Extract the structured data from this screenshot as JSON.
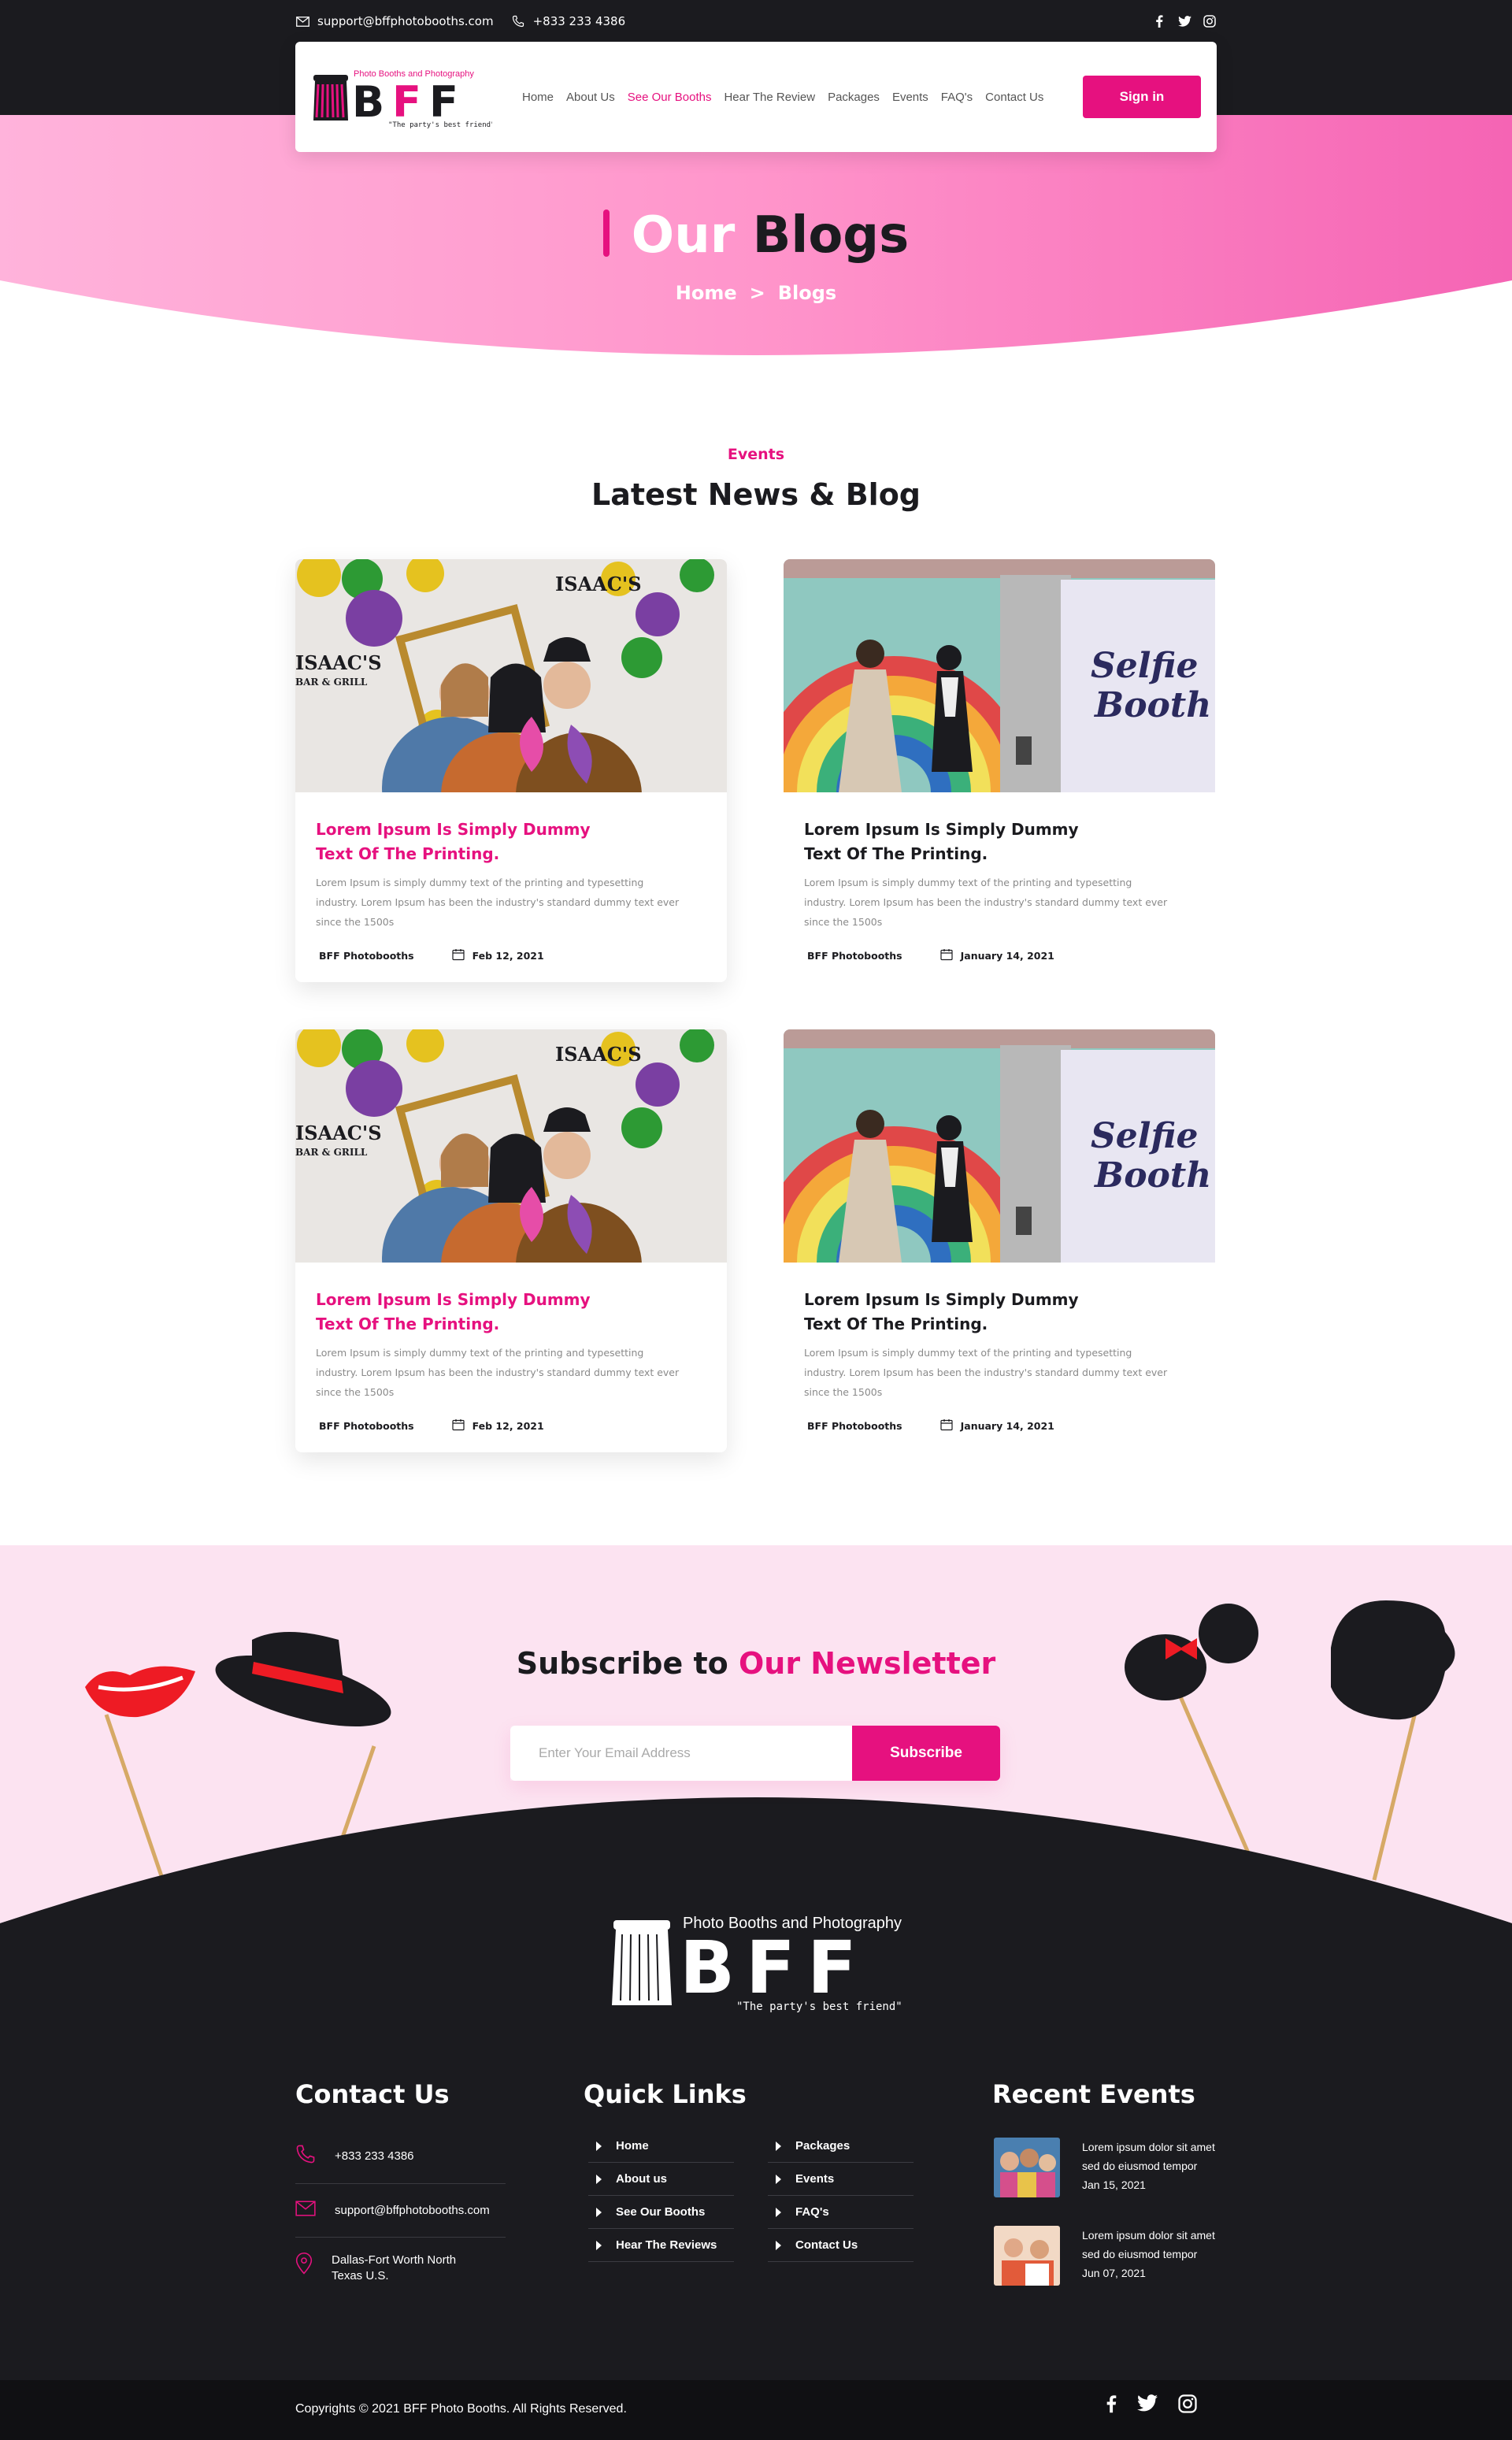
{
  "topbar": {
    "email": "support@bffphotobooths.com",
    "phone": "+833 233 4386"
  },
  "brand": {
    "name": "BFF",
    "tagline_top": "Photo Booths and Photography",
    "tagline_bottom": "\"The party's best friend\""
  },
  "nav": {
    "items": [
      {
        "label": "Home",
        "active": false
      },
      {
        "label": "About Us",
        "active": false
      },
      {
        "label": "See Our Booths",
        "active": true
      },
      {
        "label": "Hear The Review",
        "active": false
      },
      {
        "label": "Packages",
        "active": false
      },
      {
        "label": "Events",
        "active": false
      },
      {
        "label": "FAQ's",
        "active": false
      },
      {
        "label": "Contact Us",
        "active": false
      }
    ],
    "signin_label": "Sign in"
  },
  "hero": {
    "title_word1": "Our",
    "title_word2": "Blogs",
    "breadcrumb_home": "Home",
    "breadcrumb_sep": ">",
    "breadcrumb_current": "Blogs"
  },
  "blog": {
    "tag": "Events",
    "title": "Latest News & Blog",
    "posts": [
      {
        "title": "Lorem Ipsum Is Simply Dummy Text Of The Printing.",
        "desc": "Lorem Ipsum is simply dummy text of the printing and typesetting industry. Lorem Ipsum has been the industry's standard dummy text ever since the 1500s",
        "author": "BFF Photobooths",
        "date": "Feb 12, 2021",
        "image": "party-frame-photo"
      },
      {
        "title": "Lorem Ipsum Is Simply Dummy Text Of The Printing.",
        "desc": "Lorem Ipsum is simply dummy text of the printing and typesetting industry. Lorem Ipsum has been the industry's standard dummy text ever since the 1500s",
        "author": "BFF Photobooths",
        "date": "January 14, 2021",
        "image": "selfie-booth-photo"
      },
      {
        "title": "Lorem Ipsum Is Simply Dummy Text Of The Printing.",
        "desc": "Lorem Ipsum is simply dummy text of the printing and typesetting industry. Lorem Ipsum has been the industry's standard dummy text ever since the 1500s",
        "author": "BFF Photobooths",
        "date": "Feb 12, 2021",
        "image": "party-frame-photo"
      },
      {
        "title": "Lorem Ipsum Is Simply Dummy Text Of The Printing.",
        "desc": "Lorem Ipsum is simply dummy text of the printing and typesetting industry. Lorem Ipsum has been the industry's standard dummy text ever since the 1500s",
        "author": "BFF Photobooths",
        "date": "January 14, 2021",
        "image": "selfie-booth-photo"
      }
    ],
    "image_text": {
      "isaacs": "ISAAC'S",
      "bar_grill": "BAR & GRILL",
      "selfie": "Selfie",
      "booth": "Booth"
    }
  },
  "newsletter": {
    "title_plain": "Subscribe to",
    "title_accent": "Our Newsletter",
    "placeholder": "Enter Your Email Address",
    "button": "Subscribe"
  },
  "footer": {
    "contact_title": "Contact Us",
    "phone": "+833 233 4386",
    "email": "support@bffphotobooths.com",
    "address_line1": "Dallas-Fort Worth North",
    "address_line2": "Texas U.S.",
    "links_title": "Quick Links",
    "links_col1": [
      "Home",
      "About us",
      "See Our Booths",
      "Hear The Reviews"
    ],
    "links_col2": [
      "Packages",
      "Events",
      "FAQ's",
      "Contact Us"
    ],
    "events_title": "Recent Events",
    "events": [
      {
        "line1": "Lorem ipsum dolor sit amet",
        "line2": "sed do eiusmod tempor",
        "date": "Jan 15, 2021"
      },
      {
        "line1": "Lorem ipsum dolor sit amet",
        "line2": "sed do eiusmod tempor",
        "date": "Jun 07, 2021"
      }
    ],
    "copyright": "Copyrights © 2021 BFF Photo Booths. All Rights Reserved."
  },
  "colors": {
    "accent": "#e6117f",
    "dark": "#1b1b1f",
    "newsletter_bg": "#fce3f1",
    "hero_pink": "#f76ab8"
  }
}
